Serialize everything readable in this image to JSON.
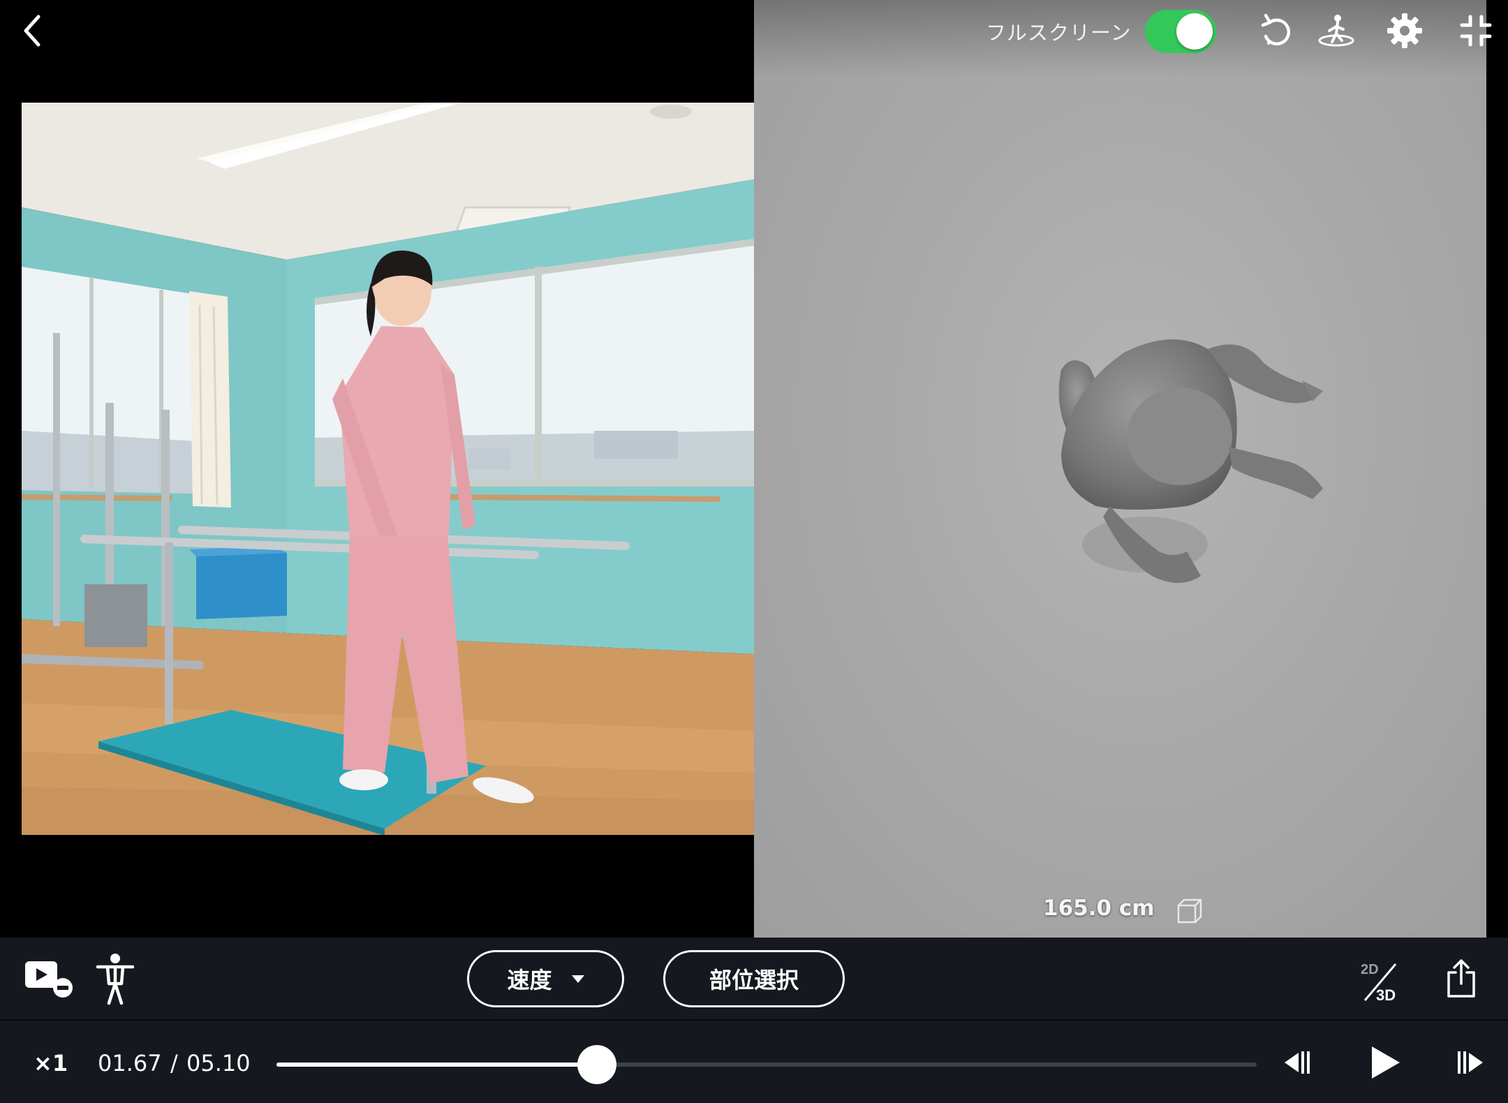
{
  "toolbar": {
    "fullscreen_label": "フルスクリーン",
    "fullscreen_on": true,
    "icons": [
      "back-chevron-icon",
      "reset-rotate-icon",
      "body-orientation-icon",
      "gear-icon",
      "exit-fullscreen-icon"
    ]
  },
  "model_view": {
    "height_label": "165.0 cm",
    "cube_icon": "bounding-box-icon"
  },
  "controls": {
    "speed_button": "速度",
    "part_select_button": "部位選択",
    "mode_label_2d": "2D",
    "mode_label_3d": "3D",
    "icons": [
      "video-remove-icon",
      "body-figure-icon",
      "dimension-toggle-icon",
      "share-icon"
    ]
  },
  "playback": {
    "speed": "×1",
    "current_time": "01.67",
    "separator": "/",
    "total_time": "05.10",
    "progress": 0.327,
    "icons": [
      "step-back-icon",
      "play-icon",
      "step-forward-icon"
    ]
  },
  "colors": {
    "toggle_on": "#34c759",
    "bar_bg": "#15191f",
    "wall": "#7fcbcb",
    "floor": "#c99560",
    "mat": "#2ba4b6",
    "outfit": "#e9a9b0"
  }
}
